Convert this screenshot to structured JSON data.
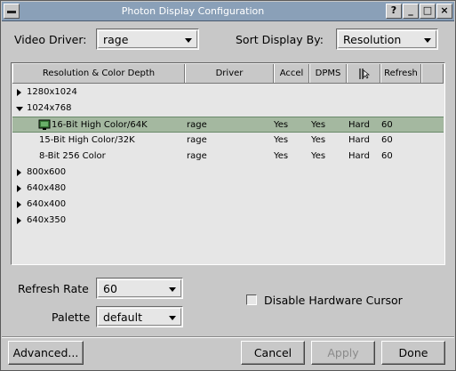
{
  "window": {
    "title": "Photon Display Configuration",
    "titlebar_buttons": [
      "?",
      "_",
      "□",
      "×"
    ]
  },
  "video_driver": {
    "label": "Video Driver:",
    "value": "rage"
  },
  "sort_display": {
    "label": "Sort Display By:",
    "value": "Resolution"
  },
  "table": {
    "columns": [
      "Resolution & Color Depth",
      "Driver",
      "Accel",
      "DPMS",
      "Refresh"
    ],
    "hw_cursor_icon": "cursor-column-icon",
    "rows": [
      {
        "kind": "group",
        "expanded": false,
        "label": "1280x1024"
      },
      {
        "kind": "group",
        "expanded": true,
        "label": "1024x768"
      },
      {
        "kind": "mode",
        "selected": true,
        "icon": "monitor-icon",
        "label": "16-Bit High Color/64K",
        "driver": "rage",
        "accel": "Yes",
        "dpms": "Yes",
        "cursor": "Hard",
        "refresh": "60"
      },
      {
        "kind": "mode",
        "selected": false,
        "label": "15-Bit High Color/32K",
        "driver": "rage",
        "accel": "Yes",
        "dpms": "Yes",
        "cursor": "Hard",
        "refresh": "60"
      },
      {
        "kind": "mode",
        "selected": false,
        "label": "8-Bit 256 Color",
        "driver": "rage",
        "accel": "Yes",
        "dpms": "Yes",
        "cursor": "Hard",
        "refresh": "60"
      },
      {
        "kind": "group",
        "expanded": false,
        "label": "800x600"
      },
      {
        "kind": "group",
        "expanded": false,
        "label": "640x480"
      },
      {
        "kind": "group",
        "expanded": false,
        "label": "640x400"
      },
      {
        "kind": "group",
        "expanded": false,
        "label": "640x350"
      }
    ]
  },
  "refresh_rate": {
    "label": "Refresh Rate",
    "value": "60"
  },
  "palette": {
    "label": "Palette",
    "value": "default"
  },
  "hw_cursor_checkbox": {
    "label": "Disable Hardware Cursor",
    "checked": false
  },
  "buttons": {
    "advanced": "Advanced...",
    "cancel": "Cancel",
    "apply": "Apply",
    "done": "Done"
  },
  "colors": {
    "titlebar": "#8aa0b8",
    "selection": "#a4b8a0",
    "background": "#c8c8c8"
  }
}
